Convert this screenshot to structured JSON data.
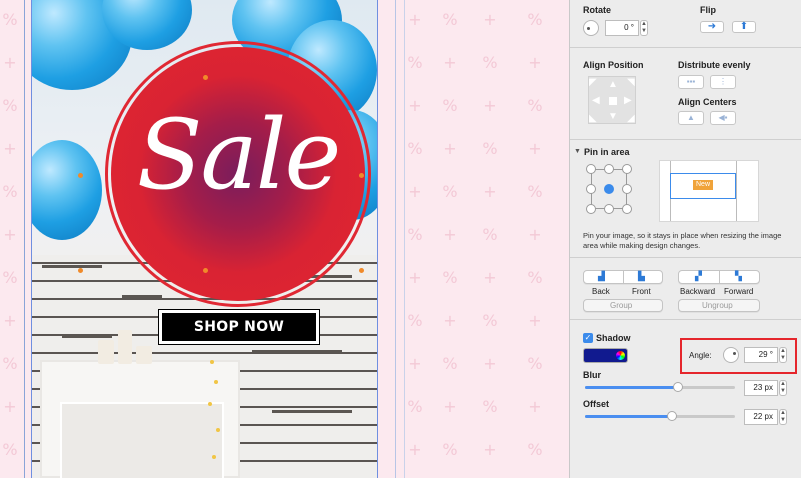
{
  "canvas": {
    "pattern_glyphs": [
      "%",
      "+"
    ],
    "badge_text": "Sale",
    "shop_button_label": "SHOP NOW",
    "colors": {
      "badge_red": "#e32531",
      "badge_inner": "#7a1d5c",
      "balloon_blue": "#1e9fe3",
      "background_pink": "#fce9ef"
    }
  },
  "rotate": {
    "title": "Rotate",
    "value": "0 °"
  },
  "flip": {
    "title": "Flip",
    "horizontal_icon": "arrow-right-icon",
    "vertical_icon": "arrow-up-icon"
  },
  "align": {
    "title": "Align Position",
    "distribute_title": "Distribute evenly",
    "align_centers_title": "Align Centers"
  },
  "pin": {
    "title": "Pin in area",
    "preview_label": "New",
    "description": "Pin your image, so it stays in place when resizing the image area while making design changes."
  },
  "arrange": {
    "back": "Back",
    "front": "Front",
    "backward": "Backward",
    "forward": "Forward",
    "group": "Group",
    "ungroup": "Ungroup"
  },
  "shadow": {
    "checkbox_label": "Shadow",
    "checked": true,
    "color": "#111a8f",
    "angle_label": "Angle:",
    "angle_value": "29 °",
    "blur_label": "Blur",
    "blur_value": "23 px",
    "blur_fraction": 0.62,
    "offset_label": "Offset",
    "offset_value": "22 px",
    "offset_fraction": 0.58
  }
}
